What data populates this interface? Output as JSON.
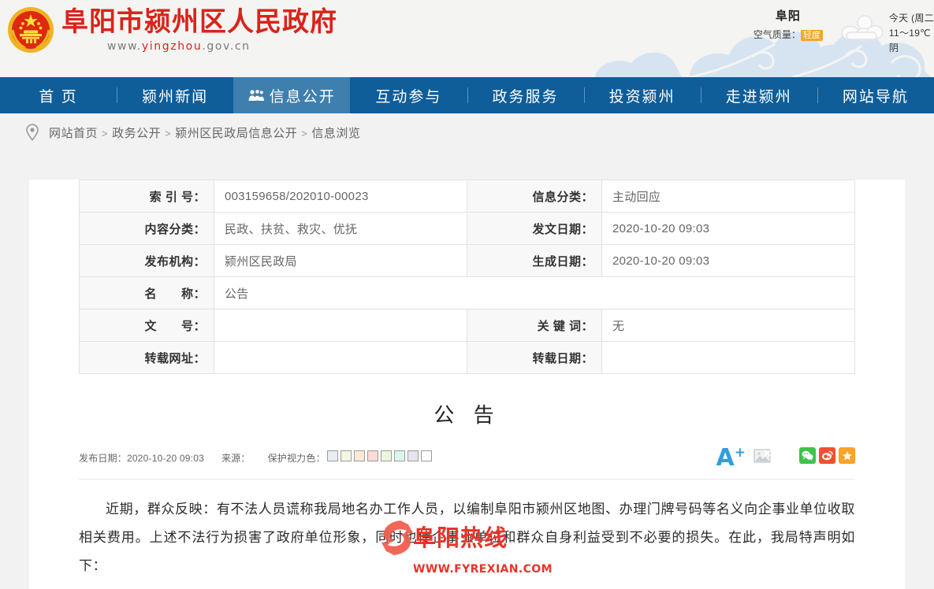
{
  "site": {
    "title": "阜阳市颍州区人民政府",
    "url_prefix": "www.",
    "url_mid": "yingzhou",
    "url_suffix": ".gov.cn",
    "emblem_icon": "national-emblem-icon",
    "brand_red": "#d9241b",
    "nav_blue": "#0f5d99",
    "nav_active_blue": "#3f7fae"
  },
  "weather": {
    "city": "阜阳",
    "aqi_label": "空气质量：",
    "aqi_value": "轻度",
    "aqi_color": "#f5a623",
    "icon": "cloudy-icon",
    "forecast_day": "今天 (周二",
    "forecast_temp": "11～19℃",
    "forecast_condition": "阴"
  },
  "nav": {
    "items": [
      {
        "label": "首 页",
        "icon": null,
        "active": false
      },
      {
        "label": "颍州新闻",
        "icon": null,
        "active": false
      },
      {
        "label": "信息公开",
        "icon": "group-people-icon",
        "active": true
      },
      {
        "label": "互动参与",
        "icon": null,
        "active": false
      },
      {
        "label": "政务服务",
        "icon": null,
        "active": false
      },
      {
        "label": "投资颍州",
        "icon": null,
        "active": false
      },
      {
        "label": "走进颍州",
        "icon": null,
        "active": false
      },
      {
        "label": "网站导航",
        "icon": null,
        "active": false
      }
    ]
  },
  "breadcrumb": {
    "icon": "location-pin-icon",
    "separator": ">",
    "items": [
      "网站首页",
      "政务公开",
      "颍州区民政局信息公开",
      "信息浏览"
    ]
  },
  "info_table": {
    "rows": [
      {
        "left_label": "索 引 号：",
        "left_value": "003159658/202010-00023",
        "right_label": "信息分类：",
        "right_value": "主动回应"
      },
      {
        "left_label": "内容分类：",
        "left_value": "民政、扶贫、救灾、优抚",
        "right_label": "发文日期：",
        "right_value": "2020-10-20 09:03"
      },
      {
        "left_label": "发布机构：",
        "left_value": "颍州区民政局",
        "right_label": "生成日期：",
        "right_value": "2020-10-20 09:03"
      }
    ],
    "full_row": {
      "label": "名　　称：",
      "value": "公告"
    },
    "row_wenhao": {
      "left_label": "文　　号：",
      "left_value": "",
      "right_label": "关 键 词：",
      "right_value": "无"
    },
    "row_reprint": {
      "left_label": "转载网址：",
      "left_value": "",
      "right_label": "转载日期：",
      "right_value": ""
    }
  },
  "article": {
    "title": "公 告",
    "meta_date_label": "发布日期：",
    "meta_date_value": "2020-10-20 09:03",
    "meta_source_label": "来源：",
    "meta_source_value": "",
    "meta_eye_label": "保护视力色：",
    "eye_colors": [
      "#e8edf2",
      "#f4f6e3",
      "#fce9d8",
      "#fbdcd6",
      "#eaf7dc",
      "#d9f7ec",
      "#e6e4ec",
      "#ffffff"
    ],
    "font_increase_label": "A",
    "font_increase_sup": "+",
    "broken_image_icon": "broken-image-icon",
    "share": [
      {
        "name": "wechat-share-button",
        "color": "#3dc44b",
        "icon": "wechat-icon"
      },
      {
        "name": "weibo-share-button",
        "color": "#f24f2e",
        "icon": "weibo-icon"
      },
      {
        "name": "favorite-share-button",
        "color": "#fba324",
        "icon": "star-icon"
      }
    ],
    "body": "近期，群众反映：有不法人员谎称我局地名办工作人员，以编制阜阳市颍州区地图、办理门牌号码等名义向企事业单位收取相关费用。上述不法行为损害了政府单位形象，同时也使企事业单位和群众自身利益受到不必要的损失。在此，我局特声明如下："
  },
  "watermark": {
    "logo_icon": "flame-swirl-icon",
    "text": "阜阳热线",
    "url": "WWW.FYREXIAN.COM",
    "color": "#e8342a"
  }
}
